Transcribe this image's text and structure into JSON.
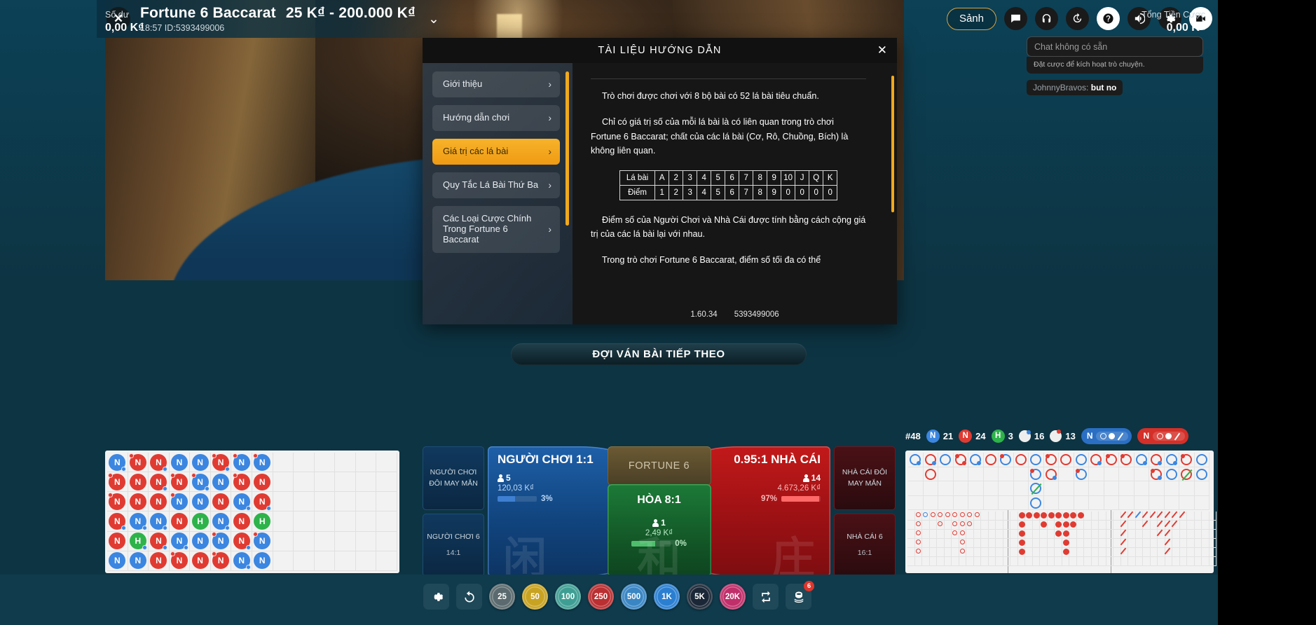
{
  "header": {
    "close_label": "✕",
    "title": "Fortune 6 Baccarat  25 K₫ - 200.000 K₫",
    "title_plain": "Fortune 6 Baccarat",
    "limits": "25 K₫ - 200.000 K₫",
    "time": "18:57",
    "round_id": "ID:5393499006",
    "subtitle": "18:57 ID:5393499006",
    "chevron": "⌄"
  },
  "toolbar": {
    "lobby_label": "Sảnh",
    "icons": [
      {
        "name": "chat-icon",
        "glyph": "chat"
      },
      {
        "name": "headset-icon",
        "glyph": "headset"
      },
      {
        "name": "history-icon",
        "glyph": "history"
      },
      {
        "name": "help-icon",
        "glyph": "help"
      },
      {
        "name": "sound-icon",
        "glyph": "sound"
      },
      {
        "name": "settings-icon",
        "glyph": "gear"
      },
      {
        "name": "video-icon",
        "glyph": "video"
      }
    ]
  },
  "chat": {
    "placeholder": "Chat không có sẵn",
    "note": "Đặt cược để kích hoạt trò chuyện.",
    "message_user": "JohnnyBravos:",
    "message_text": "but no"
  },
  "modal": {
    "title": "TÀI LIỆU HƯỚNG DẪN",
    "close": "✕",
    "nav": [
      {
        "label": "Giới thiệu",
        "active": false
      },
      {
        "label": "Hướng dẫn chơi",
        "active": false
      },
      {
        "label": "Giá trị các lá bài",
        "active": true
      },
      {
        "label": "Quy Tắc Lá Bài Thứ Ba",
        "active": false
      },
      {
        "label": "Các Loại Cược Chính Trong Fortune 6 Baccarat",
        "active": false
      }
    ],
    "paragraphs": [
      "Trò chơi được chơi với 8 bộ bài có 52 lá bài tiêu chuẩn.",
      "Chỉ có giá trị số của mỗi lá bài là có liên quan trong trò chơi Fortune 6 Baccarat; chất của các lá bài (Cơ, Rô, Chuồng, Bích) là không liên quan.",
      "Điểm số của Người Chơi và Nhà Cái được tính bằng cách cộng giá trị của các lá bài lại với nhau.",
      "Trong trò chơi Fortune 6 Baccarat, điểm số tối đa có thể"
    ],
    "card_table": {
      "row_labels": [
        "Lá bài",
        "Điểm"
      ],
      "cards": [
        "A",
        "2",
        "3",
        "4",
        "5",
        "6",
        "7",
        "8",
        "9",
        "10",
        "J",
        "Q",
        "K"
      ],
      "points": [
        "1",
        "2",
        "3",
        "4",
        "5",
        "6",
        "7",
        "8",
        "9",
        "0",
        "0",
        "0",
        "0"
      ]
    },
    "footer_version": "1.60.34",
    "footer_id": "5393499006"
  },
  "status_banner": "ĐỢI VÁN BÀI TIẾP THEO",
  "betting": {
    "player": {
      "label": "NGƯỜI CHƠI",
      "odds": "1:1",
      "players_count": "5",
      "amount": "120,03 K₫",
      "percent": "3%",
      "percent_value": 3,
      "cjk": "闲",
      "color": "#1e5fa8"
    },
    "banker": {
      "label": "NHÀ CÁI",
      "odds": "0.95:1",
      "players_count": "14",
      "amount": "4.673,26 K₫",
      "percent": "97%",
      "percent_value": 97,
      "cjk": "庄",
      "color": "#c2191a"
    },
    "tie": {
      "label": "HÒA",
      "odds": "8:1",
      "players_count": "1",
      "amount": "2,49 K₫",
      "percent": "0%",
      "percent_value": 0,
      "cjk": "和",
      "color": "#1c7a37"
    },
    "fortune6": {
      "label": "FORTUNE 6"
    },
    "side_left": [
      {
        "label": "NGƯỜI CHƠI ĐÔI MAY MẮN",
        "odds": ""
      },
      {
        "label": "NGƯỜI CHƠI 6",
        "odds": "14:1"
      }
    ],
    "side_right": [
      {
        "label": "NHÀ CÁI ĐÔI MAY MẮN",
        "odds": ""
      },
      {
        "label": "NHÀ CÁI 6",
        "odds": "16:1"
      }
    ]
  },
  "roadmap_stats": {
    "round_label": "#48",
    "player": {
      "badge": "N",
      "count": "21",
      "color": "#3b86e0"
    },
    "banker": {
      "badge": "N",
      "count": "24",
      "color": "#e03b32"
    },
    "tie": {
      "badge": "H",
      "count": "3",
      "color": "#2eb34a"
    },
    "player_pair": "16",
    "banker_pair": "13",
    "predict_player": "N",
    "predict_banker": "N"
  },
  "bead_road": {
    "rows": [
      [
        {
          "v": "N",
          "c": "P",
          "tl": "",
          "br": "blue"
        },
        {
          "v": "N",
          "c": "B",
          "tl": "red",
          "br": ""
        },
        {
          "v": "N",
          "c": "B",
          "tl": "",
          "br": "blue"
        },
        {
          "v": "N",
          "c": "P",
          "tl": "",
          "br": ""
        },
        {
          "v": "N",
          "c": "P",
          "tl": "",
          "br": ""
        },
        {
          "v": "N",
          "c": "B",
          "tl": "red",
          "br": "blue"
        },
        {
          "v": "N",
          "c": "P",
          "tl": "red",
          "br": ""
        },
        {
          "v": "N",
          "c": "P",
          "tl": "red",
          "br": ""
        }
      ],
      [
        {
          "v": "N",
          "c": "B",
          "tl": "red",
          "br": ""
        },
        {
          "v": "N",
          "c": "B",
          "tl": "",
          "br": ""
        },
        {
          "v": "N",
          "c": "B",
          "tl": "",
          "br": "blue"
        },
        {
          "v": "N",
          "c": "B",
          "tl": "red",
          "br": ""
        },
        {
          "v": "N",
          "c": "P",
          "tl": "red",
          "br": "blue"
        },
        {
          "v": "N",
          "c": "P",
          "tl": "",
          "br": ""
        },
        {
          "v": "N",
          "c": "B",
          "tl": "red",
          "br": ""
        },
        {
          "v": "N",
          "c": "B",
          "tl": "",
          "br": ""
        }
      ],
      [
        {
          "v": "N",
          "c": "B",
          "tl": "red",
          "br": ""
        },
        {
          "v": "N",
          "c": "B",
          "tl": "",
          "br": ""
        },
        {
          "v": "N",
          "c": "B",
          "tl": "",
          "br": ""
        },
        {
          "v": "N",
          "c": "P",
          "tl": "red",
          "br": ""
        },
        {
          "v": "N",
          "c": "P",
          "tl": "",
          "br": ""
        },
        {
          "v": "N",
          "c": "B",
          "tl": "",
          "br": ""
        },
        {
          "v": "N",
          "c": "P",
          "tl": "",
          "br": "blue"
        },
        {
          "v": "N",
          "c": "B",
          "tl": "",
          "br": "blue"
        }
      ],
      [
        {
          "v": "N",
          "c": "B",
          "tl": "",
          "br": "blue"
        },
        {
          "v": "N",
          "c": "P",
          "tl": "",
          "br": "blue"
        },
        {
          "v": "N",
          "c": "P",
          "tl": "",
          "br": "blue"
        },
        {
          "v": "N",
          "c": "B",
          "tl": "",
          "br": ""
        },
        {
          "v": "H",
          "c": "T",
          "tl": "",
          "br": ""
        },
        {
          "v": "N",
          "c": "P",
          "tl": "",
          "br": "blue"
        },
        {
          "v": "N",
          "c": "B",
          "tl": "",
          "br": ""
        },
        {
          "v": "H",
          "c": "T",
          "tl": "",
          "br": ""
        }
      ],
      [
        {
          "v": "N",
          "c": "B",
          "tl": "",
          "br": ""
        },
        {
          "v": "H",
          "c": "T",
          "tl": "",
          "br": "blue"
        },
        {
          "v": "N",
          "c": "B",
          "tl": "",
          "br": "blue"
        },
        {
          "v": "N",
          "c": "P",
          "tl": "",
          "br": "blue"
        },
        {
          "v": "N",
          "c": "P",
          "tl": "",
          "br": ""
        },
        {
          "v": "N",
          "c": "P",
          "tl": "red",
          "br": ""
        },
        {
          "v": "N",
          "c": "B",
          "tl": "",
          "br": "blue"
        },
        {
          "v": "N",
          "c": "P",
          "tl": "red",
          "br": ""
        }
      ],
      [
        {
          "v": "N",
          "c": "P",
          "tl": "",
          "br": ""
        },
        {
          "v": "N",
          "c": "P",
          "tl": "",
          "br": ""
        },
        {
          "v": "N",
          "c": "B",
          "tl": "",
          "br": ""
        },
        {
          "v": "N",
          "c": "B",
          "tl": "red",
          "br": ""
        },
        {
          "v": "N",
          "c": "B",
          "tl": "",
          "br": ""
        },
        {
          "v": "N",
          "c": "B",
          "tl": "red",
          "br": ""
        },
        {
          "v": "N",
          "c": "P",
          "tl": "",
          "br": "blue"
        },
        {
          "v": "N",
          "c": "P",
          "tl": "",
          "br": ""
        }
      ]
    ]
  },
  "big_road": {
    "columns": [
      [
        {
          "c": "P",
          "tl": "",
          "br": "blue"
        }
      ],
      [
        {
          "c": "B",
          "tl": "",
          "br": "blue"
        },
        {
          "c": "B",
          "tl": "",
          "br": ""
        }
      ],
      [
        {
          "c": "P",
          "tl": "",
          "br": ""
        }
      ],
      [
        {
          "c": "B",
          "tl": "red",
          "br": "red"
        }
      ],
      [
        {
          "c": "P",
          "tl": "",
          "br": "blue"
        }
      ],
      [
        {
          "c": "B",
          "tl": "",
          "br": ""
        }
      ],
      [
        {
          "c": "P",
          "tl": "red",
          "br": ""
        }
      ],
      [
        {
          "c": "B",
          "tl": "",
          "br": ""
        }
      ],
      [
        {
          "c": "P",
          "tl": "",
          "br": ""
        },
        {
          "c": "P",
          "tl": "red",
          "br": ""
        },
        {
          "c": "P",
          "tl": "",
          "br": "slashg"
        },
        {
          "c": "P",
          "tl": "",
          "br": ""
        }
      ],
      [
        {
          "c": "B",
          "tl": "red",
          "br": ""
        },
        {
          "c": "B",
          "tl": "",
          "br": "blue"
        }
      ],
      [
        {
          "c": "B",
          "tl": "",
          "br": ""
        }
      ],
      [
        {
          "c": "P",
          "tl": "",
          "br": ""
        },
        {
          "c": "P",
          "tl": "red",
          "br": ""
        }
      ],
      [
        {
          "c": "B",
          "tl": "",
          "br": "blue"
        }
      ],
      [
        {
          "c": "B",
          "tl": "red",
          "br": ""
        }
      ],
      [
        {
          "c": "B",
          "tl": "red",
          "br": ""
        }
      ],
      [
        {
          "c": "P",
          "tl": "",
          "br": "blue"
        }
      ],
      [
        {
          "c": "B",
          "tl": "",
          "br": "blue"
        },
        {
          "c": "B",
          "tl": "red",
          "br": "blue"
        }
      ],
      [
        {
          "c": "P",
          "tl": "",
          "br": "blue"
        },
        {
          "c": "P",
          "tl": "",
          "br": ""
        }
      ],
      [
        {
          "c": "B",
          "tl": "red",
          "br": ""
        },
        {
          "c": "B",
          "tl": "",
          "br": "slashg"
        }
      ],
      [
        {
          "c": "P",
          "tl": "",
          "br": ""
        },
        {
          "c": "P",
          "tl": "",
          "br": ""
        }
      ]
    ]
  },
  "balance": {
    "label": "Số dư",
    "value": "0,00 K₫"
  },
  "total_bet": {
    "label": "Tổng Tiền Cược",
    "value": "0,00 K₫"
  },
  "chips": {
    "settings_icon": "gear-icon",
    "undo_icon": "undo-icon",
    "repeat_icon": "repeat-icon",
    "double_icon": "double-icon",
    "double_badge": "6",
    "values": [
      {
        "label": "25",
        "color": "#5b6a6e"
      },
      {
        "label": "50",
        "color": "#c8a322"
      },
      {
        "label": "100",
        "color": "#3f9e93"
      },
      {
        "label": "250",
        "color": "#ba2f31"
      },
      {
        "label": "500",
        "color": "#3a86c4"
      },
      {
        "label": "1K",
        "color": "#2b7fd1"
      },
      {
        "label": "5K",
        "color": "#1b2736"
      },
      {
        "label": "20K",
        "color": "#c02f6a"
      }
    ]
  }
}
